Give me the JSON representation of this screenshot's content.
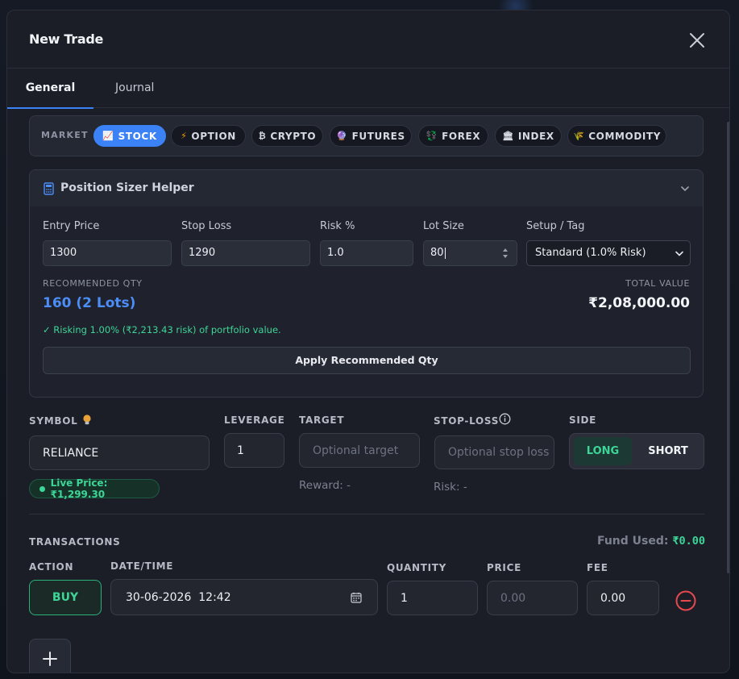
{
  "modal": {
    "title": "New Trade",
    "tabs": [
      {
        "label": "General",
        "active": true
      },
      {
        "label": "Journal",
        "active": false
      }
    ]
  },
  "market": {
    "label": "MARKET",
    "options": [
      {
        "label": "STOCK",
        "icon": "chart-icon",
        "glyph": "📈",
        "active": true
      },
      {
        "label": "OPTION",
        "icon": "lightning-icon",
        "glyph": "⚡",
        "active": false
      },
      {
        "label": "CRYPTO",
        "icon": "bitcoin-icon",
        "glyph": "₿",
        "active": false
      },
      {
        "label": "FUTURES",
        "icon": "crystal-ball-icon",
        "glyph": "🔮",
        "active": false
      },
      {
        "label": "FOREX",
        "icon": "exchange-icon",
        "glyph": "💱",
        "active": false
      },
      {
        "label": "INDEX",
        "icon": "bank-icon",
        "glyph": "🏛",
        "active": false
      },
      {
        "label": "COMMODITY",
        "icon": "wheat-icon",
        "glyph": "🌾",
        "active": false
      }
    ]
  },
  "sizer": {
    "title": "Position Sizer Helper",
    "entry_label": "Entry Price",
    "entry_value": "1300",
    "stop_label": "Stop Loss",
    "stop_value": "1290",
    "risk_label": "Risk %",
    "risk_value": "1.0",
    "lot_label": "Lot Size",
    "lot_value": "80",
    "setup_label": "Setup / Tag",
    "setup_value": "Standard (1.0% Risk)",
    "rec_label": "RECOMMENDED QTY",
    "rec_value": "160 (2 Lots)",
    "total_label": "TOTAL VALUE",
    "total_value": "₹2,08,000.00",
    "risk_note": "✓ Risking 1.00% (₹2,213.43 risk) of portfolio value.",
    "apply_label": "Apply Recommended Qty"
  },
  "form": {
    "symbol_label": "SYMBOL",
    "symbol_value": "RELIANCE",
    "live_price": "Live Price: ₹1,299.30",
    "leverage_label": "LEVERAGE",
    "leverage_value": "1",
    "target_label": "TARGET",
    "target_placeholder": "Optional target",
    "reward_text": "Reward: -",
    "stoploss_label": "STOP-LOSS",
    "stoploss_placeholder": "Optional stop loss",
    "risk_text": "Risk: -",
    "side_label": "SIDE",
    "side_long": "LONG",
    "side_short": "SHORT",
    "side_selected": "LONG"
  },
  "transactions": {
    "title": "TRANSACTIONS",
    "fund_label": "Fund Used:",
    "fund_value": "₹0.00",
    "col_action": "ACTION",
    "col_datetime": "DATE/TIME",
    "col_quantity": "QUANTITY",
    "col_price": "PRICE",
    "col_fee": "FEE",
    "rows": [
      {
        "action": "BUY",
        "datetime": "30-06-2026  12:42",
        "quantity": "1",
        "price_placeholder": "0.00",
        "fee": "0.00"
      }
    ]
  },
  "colors": {
    "accent": "#3b82f6",
    "success": "#3ed598",
    "danger": "#e5484d",
    "surface": "#1b1e27"
  }
}
